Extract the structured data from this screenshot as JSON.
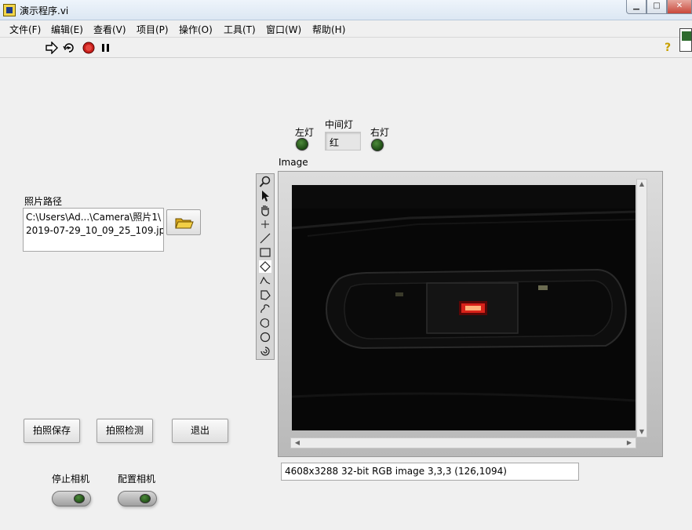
{
  "window": {
    "title": "演示程序.vi",
    "minimize_glyph": "▁",
    "maximize_glyph": "□",
    "close_glyph": "✕"
  },
  "menu": [
    "文件(F)",
    "编辑(E)",
    "查看(V)",
    "项目(P)",
    "操作(O)",
    "工具(T)",
    "窗口(W)",
    "帮助(H)"
  ],
  "toolbar": {
    "run_icon": "run-arrow-icon",
    "run_continuous_icon": "run-continuously-icon",
    "abort_icon": "abort-stop-icon",
    "pause_icon": "pause-icon",
    "help_glyph": "?"
  },
  "lights": {
    "left_label": "左灯",
    "middle_label": "中间灯",
    "middle_value": "红",
    "right_label": "右灯",
    "led_color": "#2f6b22"
  },
  "photo_path": {
    "label": "照片路径",
    "line1": "C:\\Users\\Ad...\\Camera\\照片1\\",
    "line2": "2019-07-29_10_09_25_109.jpg"
  },
  "image_display": {
    "label": "Image",
    "status": "4608x3288 32-bit RGB image 3,3,3     (126,1094)",
    "tools": [
      "zoom-icon",
      "pointer-icon",
      "pan-hand-icon",
      "point-icon",
      "line-icon",
      "rectangle-icon",
      "rotated-rectangle-icon",
      "polyline-icon",
      "polygon-icon",
      "freehand-line-icon",
      "freehand-region-icon",
      "oval-icon",
      "annulus-icon"
    ]
  },
  "buttons": {
    "capture_save": "拍照保存",
    "capture_detect": "拍照检测",
    "exit": "退出"
  },
  "switches": {
    "stop_camera": "停止相机",
    "config_camera": "配置相机"
  }
}
